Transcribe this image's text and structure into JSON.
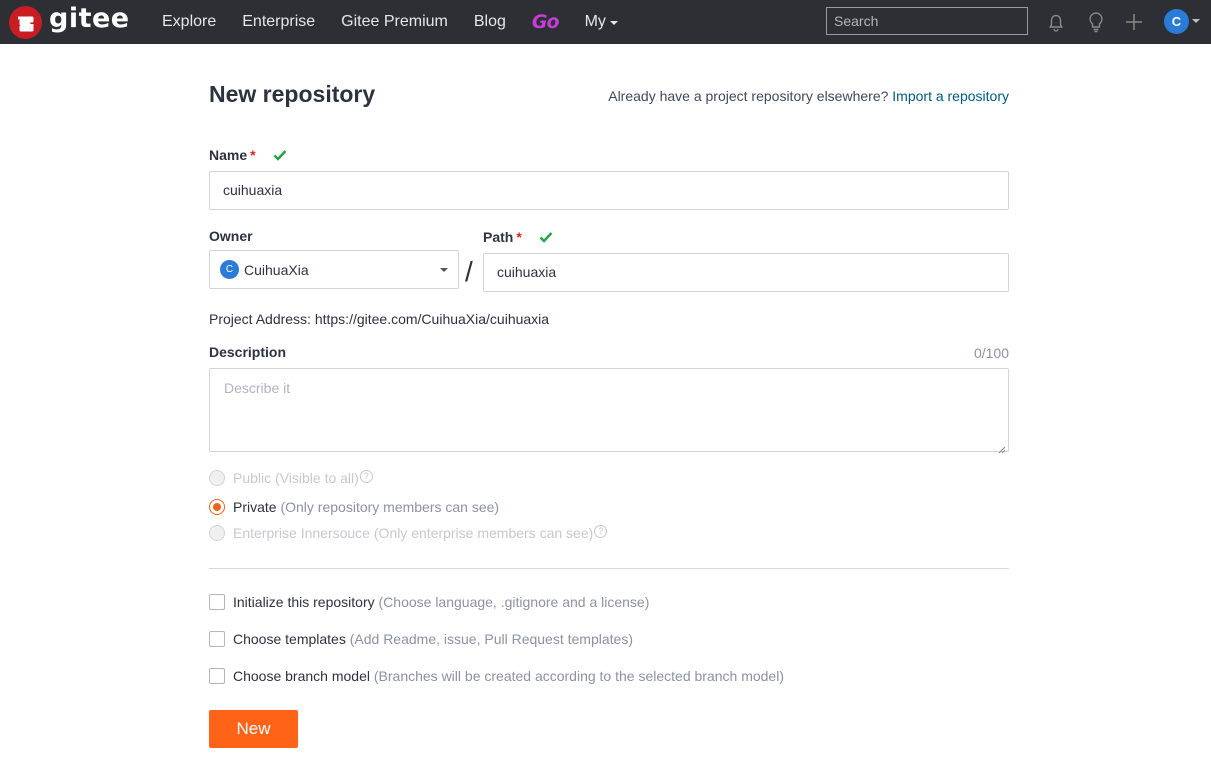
{
  "brand": {
    "name": "gitee"
  },
  "nav": {
    "items": [
      "Explore",
      "Enterprise",
      "Gitee Premium",
      "Blog"
    ],
    "go_label": "Go",
    "my_label": "My"
  },
  "search": {
    "placeholder": "Search"
  },
  "user": {
    "avatar_letter": "C"
  },
  "page": {
    "title": "New repository",
    "import_prompt": "Already have a project repository elsewhere?",
    "import_link": "Import a repository"
  },
  "form": {
    "name_label": "Name",
    "name_value": "cuihuaxia",
    "owner_label": "Owner",
    "owner_value": "CuihuaXia",
    "owner_avatar_letter": "C",
    "path_label": "Path",
    "path_value": "cuihuaxia",
    "required_mark": "*",
    "slash": "/",
    "project_address": "Project Address: https://gitee.com/CuihuaXia/cuihuaxia",
    "description_label": "Description",
    "description_counter": "0/100",
    "description_placeholder": "Describe it",
    "visibility": {
      "public_label": "Public",
      "public_hint": "(Visible to all)",
      "private_label": "Private",
      "private_hint": "(Only repository members can see)",
      "enterprise_label": "Enterprise Innersouce",
      "enterprise_hint": "(Only enterprise members can see)",
      "selected": "Private"
    },
    "options": [
      {
        "label": "Initialize this repository",
        "hint": "(Choose language, .gitignore and a license)"
      },
      {
        "label": "Choose templates",
        "hint": "(Add Readme, issue, Pull Request templates)"
      },
      {
        "label": "Choose branch model",
        "hint": "(Branches will be created according to the selected branch model)"
      }
    ],
    "submit_label": "New"
  },
  "colors": {
    "topbar": "#2e2f35",
    "accent": "#fe6318",
    "brand_red": "#c71d23",
    "valid_green": "#21a343",
    "link": "#005980"
  }
}
